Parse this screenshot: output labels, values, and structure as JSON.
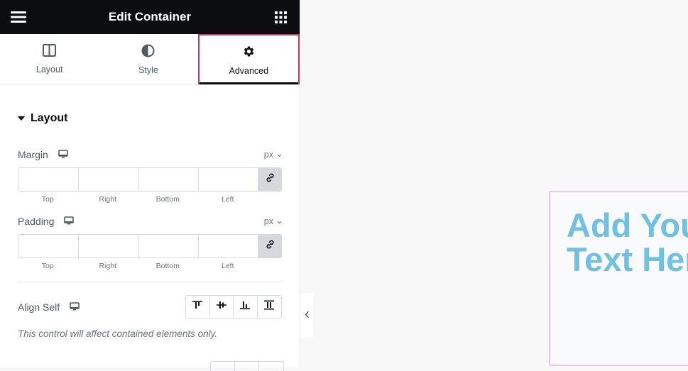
{
  "topbar": {
    "title": "Edit Container",
    "menu_icon": "hamburger-icon",
    "apps_icon": "grid-icon"
  },
  "tabs": [
    {
      "label": "Layout",
      "icon": "columns-icon",
      "active": false
    },
    {
      "label": "Style",
      "icon": "half-circle-icon",
      "active": false
    },
    {
      "label": "Advanced",
      "icon": "gear-icon",
      "active": true
    }
  ],
  "section": {
    "title": "Layout"
  },
  "margin": {
    "label": "Margin",
    "device": "desktop-icon",
    "unit": "px",
    "values": {
      "top": "",
      "right": "",
      "bottom": "",
      "left": ""
    },
    "sublabels": [
      "Top",
      "Right",
      "Bottom",
      "Left"
    ]
  },
  "padding": {
    "label": "Padding",
    "device": "desktop-icon",
    "unit": "px",
    "values": {
      "top": "",
      "right": "",
      "bottom": "",
      "left": ""
    },
    "sublabels": [
      "Top",
      "Right",
      "Bottom",
      "Left"
    ]
  },
  "align_self": {
    "label": "Align Self",
    "options": [
      "Start",
      "Center",
      "End",
      "Stretch"
    ],
    "note": "This control will affect contained elements only."
  },
  "canvas": {
    "heading": "Add Your\nText Here",
    "heading_lines": [
      "Add Your",
      "Text Here"
    ],
    "heading_color": "#6ec1e4"
  },
  "colors": {
    "accent": "#c7385e",
    "topbar": "#0c0d0e",
    "container_outline": "#f0c4f1"
  }
}
